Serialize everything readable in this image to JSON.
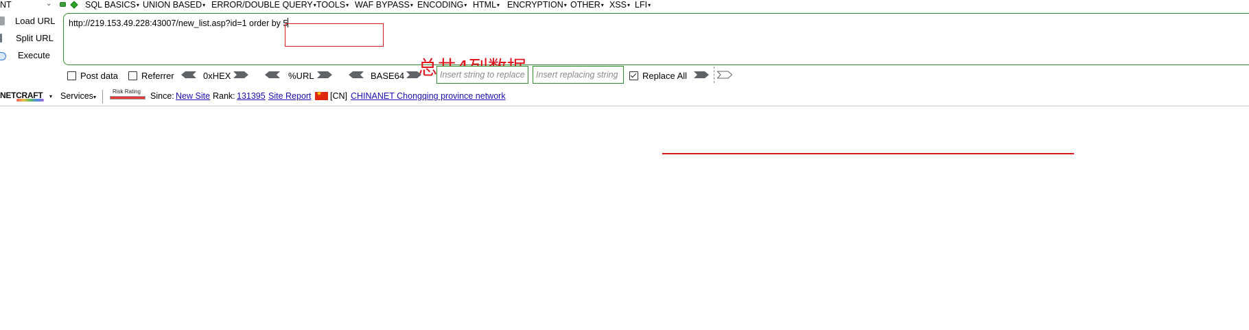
{
  "menubar": {
    "combo_value": "NT",
    "items": [
      {
        "label": "SQL BASICS",
        "arrow": "▾"
      },
      {
        "label": "UNION BASED",
        "arrow": "▾"
      },
      {
        "label": "ERROR/DOUBLE QUERY",
        "arrow": "▾"
      },
      {
        "label": "TOOLS",
        "arrow": "▾"
      },
      {
        "label": "WAF BYPASS",
        "arrow": "▾"
      },
      {
        "label": "ENCODING",
        "arrow": "▾"
      },
      {
        "label": "HTML",
        "arrow": "▾"
      },
      {
        "label": "ENCRYPTION",
        "arrow": "▾"
      },
      {
        "label": "OTHER",
        "arrow": "▾"
      },
      {
        "label": "XSS",
        "arrow": "▾"
      },
      {
        "label": "LFI",
        "arrow": "▾"
      }
    ]
  },
  "actions": {
    "load_url": "Load URL",
    "split_url": "Split URL",
    "execute": "Execute"
  },
  "url": {
    "value": "http://219.153.49.228:43007/new_list.asp?id=1 order by 5"
  },
  "annotation": {
    "text": "总共4列数据",
    "color": "#e0141c"
  },
  "options": {
    "post_data": {
      "label": "Post data",
      "checked": false
    },
    "referrer": {
      "label": "Referrer",
      "checked": false
    },
    "hex": "0xHEX",
    "url_enc": "%URL",
    "base64": "BASE64",
    "insert_string_placeholder": "Insert string to replace",
    "insert_replacing_placeholder": "Insert replacing string",
    "replace_all": {
      "label": "Replace All",
      "checked": true
    }
  },
  "netcraft": {
    "logo": "NETCRAFT",
    "services": "Services",
    "risk_label": "Risk Rating",
    "since_label": "Since:",
    "since_value": "New Site",
    "rank_label": "Rank:",
    "rank_value": "131395",
    "site_report": "Site Report",
    "country": "[CN]",
    "network": "CHINANET Chongqing province network"
  },
  "colors": {
    "accent_green": "#2f8f2f",
    "annotation_red": "#e0141c",
    "link": "#1a0dab"
  }
}
